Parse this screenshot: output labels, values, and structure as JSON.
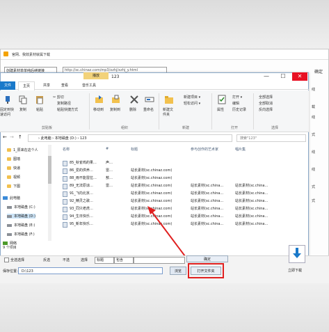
{
  "background_dialog": {
    "title": "官网、我效素材就属下载",
    "select_value": "创建素材单单纯后续链接",
    "url": "http://sc.chinaz.com/mp3/xzhj/xzhj_y.html",
    "right_link": "确定",
    "side_labels": [
      "线",
      "载",
      "线",
      "式",
      "线",
      "线",
      "式",
      "式"
    ]
  },
  "explorer": {
    "context_tab": "播放",
    "title": "123",
    "window_buttons": {
      "minimize": "—",
      "maximize": "☐",
      "close": "✕"
    },
    "ribbon_tabs": [
      "文件",
      "主页",
      "共享",
      "查看",
      "音乐工具"
    ],
    "ribbon": {
      "clipboard": {
        "pin": "固定到快速访问",
        "copy": "复制",
        "paste": "粘贴",
        "cut": "剪切",
        "copy_path": "复制路径",
        "paste_shortcut": "粘贴快捷方式",
        "group": "剪贴板"
      },
      "organize": {
        "move_to": "移动到",
        "copy_to": "复制到",
        "delete": "删除",
        "rename": "重命名",
        "group": "组织"
      },
      "new": {
        "new_folder": "新建文件夹",
        "new_item": "新建项目 ▾",
        "easy_access": "轻松访问 ▾",
        "group": "新建"
      },
      "open": {
        "properties": "属性",
        "open": "打开 ▾",
        "edit": "编辑",
        "history": "历史记录",
        "group": "打开"
      },
      "select": {
        "select_all": "全部选择",
        "select_none": "全部取消",
        "invert": "反向选择",
        "group": "选择"
      }
    },
    "address": "› 此电脑 › 本地磁盘 (D:) › 123",
    "search_placeholder": "搜索\"123\"",
    "nav_pane": [
      {
        "label": "1_原来在这个人",
        "type": "folder"
      },
      {
        "label": "图墙",
        "type": "folder"
      },
      {
        "label": "快递",
        "type": "folder"
      },
      {
        "label": "视频",
        "type": "folder"
      },
      {
        "label": "下图",
        "type": "folder"
      },
      {
        "label": "此电脑",
        "type": "pc"
      },
      {
        "label": "本地磁盘 (C:)",
        "type": "drive"
      },
      {
        "label": "本地磁盘 (D:)",
        "type": "drive"
      },
      {
        "label": "本地磁盘 (E:)",
        "type": "drive"
      },
      {
        "label": "本地磁盘 (F:)",
        "type": "drive"
      },
      {
        "label": "网络",
        "type": "net"
      }
    ],
    "columns": [
      "名称",
      "#",
      "标题",
      "参与创作的艺术家",
      "唱片集"
    ],
    "files": [
      {
        "name": "85_秋雀鸣的果…",
        "num": "声…",
        "title": "",
        "artist": "",
        "album": ""
      },
      {
        "name": "86_爱的供养…",
        "num": "雷…",
        "title": "站长素材(sc.chinaz.com)",
        "artist": "",
        "album": ""
      },
      {
        "name": "88_雨不能雷拉…",
        "num": "敖…",
        "title": "站长素材(sc.chinaz.com)",
        "artist": "",
        "album": ""
      },
      {
        "name": "89_无法原谅…",
        "num": "雷…",
        "title": "站长素材(sc.chinaz.com)",
        "artist": "站长素材(sc.china…",
        "album": "站长素材(sc.china…"
      },
      {
        "name": "91_飞向北京…",
        "num": "",
        "title": "站长素材(sc.chinaz.com)",
        "artist": "站长素材(sc.china…",
        "album": "站长素材(sc.china…"
      },
      {
        "name": "92_精灵之歌…",
        "num": "",
        "title": "站长素材(sc.chinaz.com)",
        "artist": "站长素材(sc.china…",
        "album": "站长素材(sc.china…"
      },
      {
        "name": "93_同只老虎…",
        "num": "",
        "title": "站长素材(sc.chinaz.com)",
        "artist": "站长素材(sc.china…",
        "album": "站长素材(sc.china…"
      },
      {
        "name": "94_生日快乐…",
        "num": "",
        "title": "站长素材(sc.chinaz.com)",
        "artist": "站长素材(sc.china…",
        "album": "站长素材(sc.china…"
      },
      {
        "name": "95_新年快乐…",
        "num": "",
        "title": "站长素材(sc.chinaz.com)",
        "artist": "站长素材(sc.china…",
        "album": "站长素材(sc.china…"
      }
    ],
    "status": "9 个项目"
  },
  "bottom_bar": {
    "select_all": "全选选择",
    "inverse": "反选",
    "none": "不选",
    "select_label": "选择",
    "select_value1": "标题",
    "select_value2": "包含",
    "confirm": "确定",
    "save_label": "保存位置:",
    "save_path": "D:\\123",
    "browse": "浏览",
    "open_folder": "打开文件夹",
    "download_now": "立即下载"
  },
  "colors": {
    "accent": "#1979ca",
    "highlight": "#e02020",
    "context_tab": "#f2d27a"
  }
}
